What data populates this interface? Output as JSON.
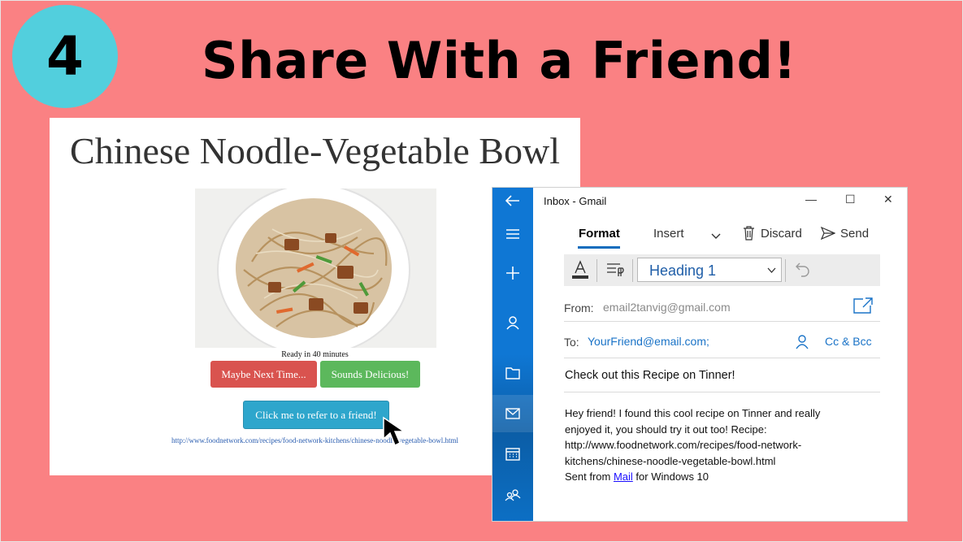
{
  "slide": {
    "step_number": "4",
    "title": "Share With a Friend!"
  },
  "recipe": {
    "title": "Chinese Noodle-Vegetable Bowl",
    "ready_text": "Ready in 40 minutes",
    "maybe_label": "Maybe Next Time...",
    "delicious_label": "Sounds Delicious!",
    "refer_label": "Click me to refer to a friend!",
    "link": "http://www.foodnetwork.com/recipes/food-network-kitchens/chinese-noodle-vegetable-bowl.html",
    "photo_icon": "noodle-bowl-photo"
  },
  "mail": {
    "window_title": "Inbox - Gmail",
    "controls": {
      "minimize": "—",
      "maximize": "☐",
      "close": "✕"
    },
    "tabs": {
      "format": "Format",
      "insert": "Insert",
      "discard": "Discard",
      "send": "Send"
    },
    "style_select": "Heading 1",
    "from_label": "From:",
    "from_value": "email2tanvig@gmail.com",
    "to_label": "To:",
    "to_value": "YourFriend@email.com;",
    "cc_bcc": "Cc & Bcc",
    "subject": "Check out this Recipe on Tinner!",
    "body": {
      "line1": "Hey friend!  I found this cool recipe on Tinner and really",
      "line2": "enjoyed it, you should try it out too!  Recipe:",
      "line3": "http://www.foodnetwork.com/recipes/food-network-",
      "line4": "kitchens/chinese-noodle-vegetable-bowl.html",
      "sent_prefix": "Sent from ",
      "sent_link": "Mail",
      "sent_suffix": " for Windows 10"
    },
    "rail_icons": [
      "back-icon",
      "menu-icon",
      "new-mail-icon",
      "account-icon",
      "folder-icon",
      "mail-icon",
      "calendar-icon",
      "people-icon"
    ]
  },
  "colors": {
    "background": "#fa8183",
    "badge": "#52cfdd",
    "btn_red": "#d9534f",
    "btn_green": "#5cb85c",
    "btn_blue": "#2ea6cc",
    "mail_accent": "#0f77d4"
  }
}
